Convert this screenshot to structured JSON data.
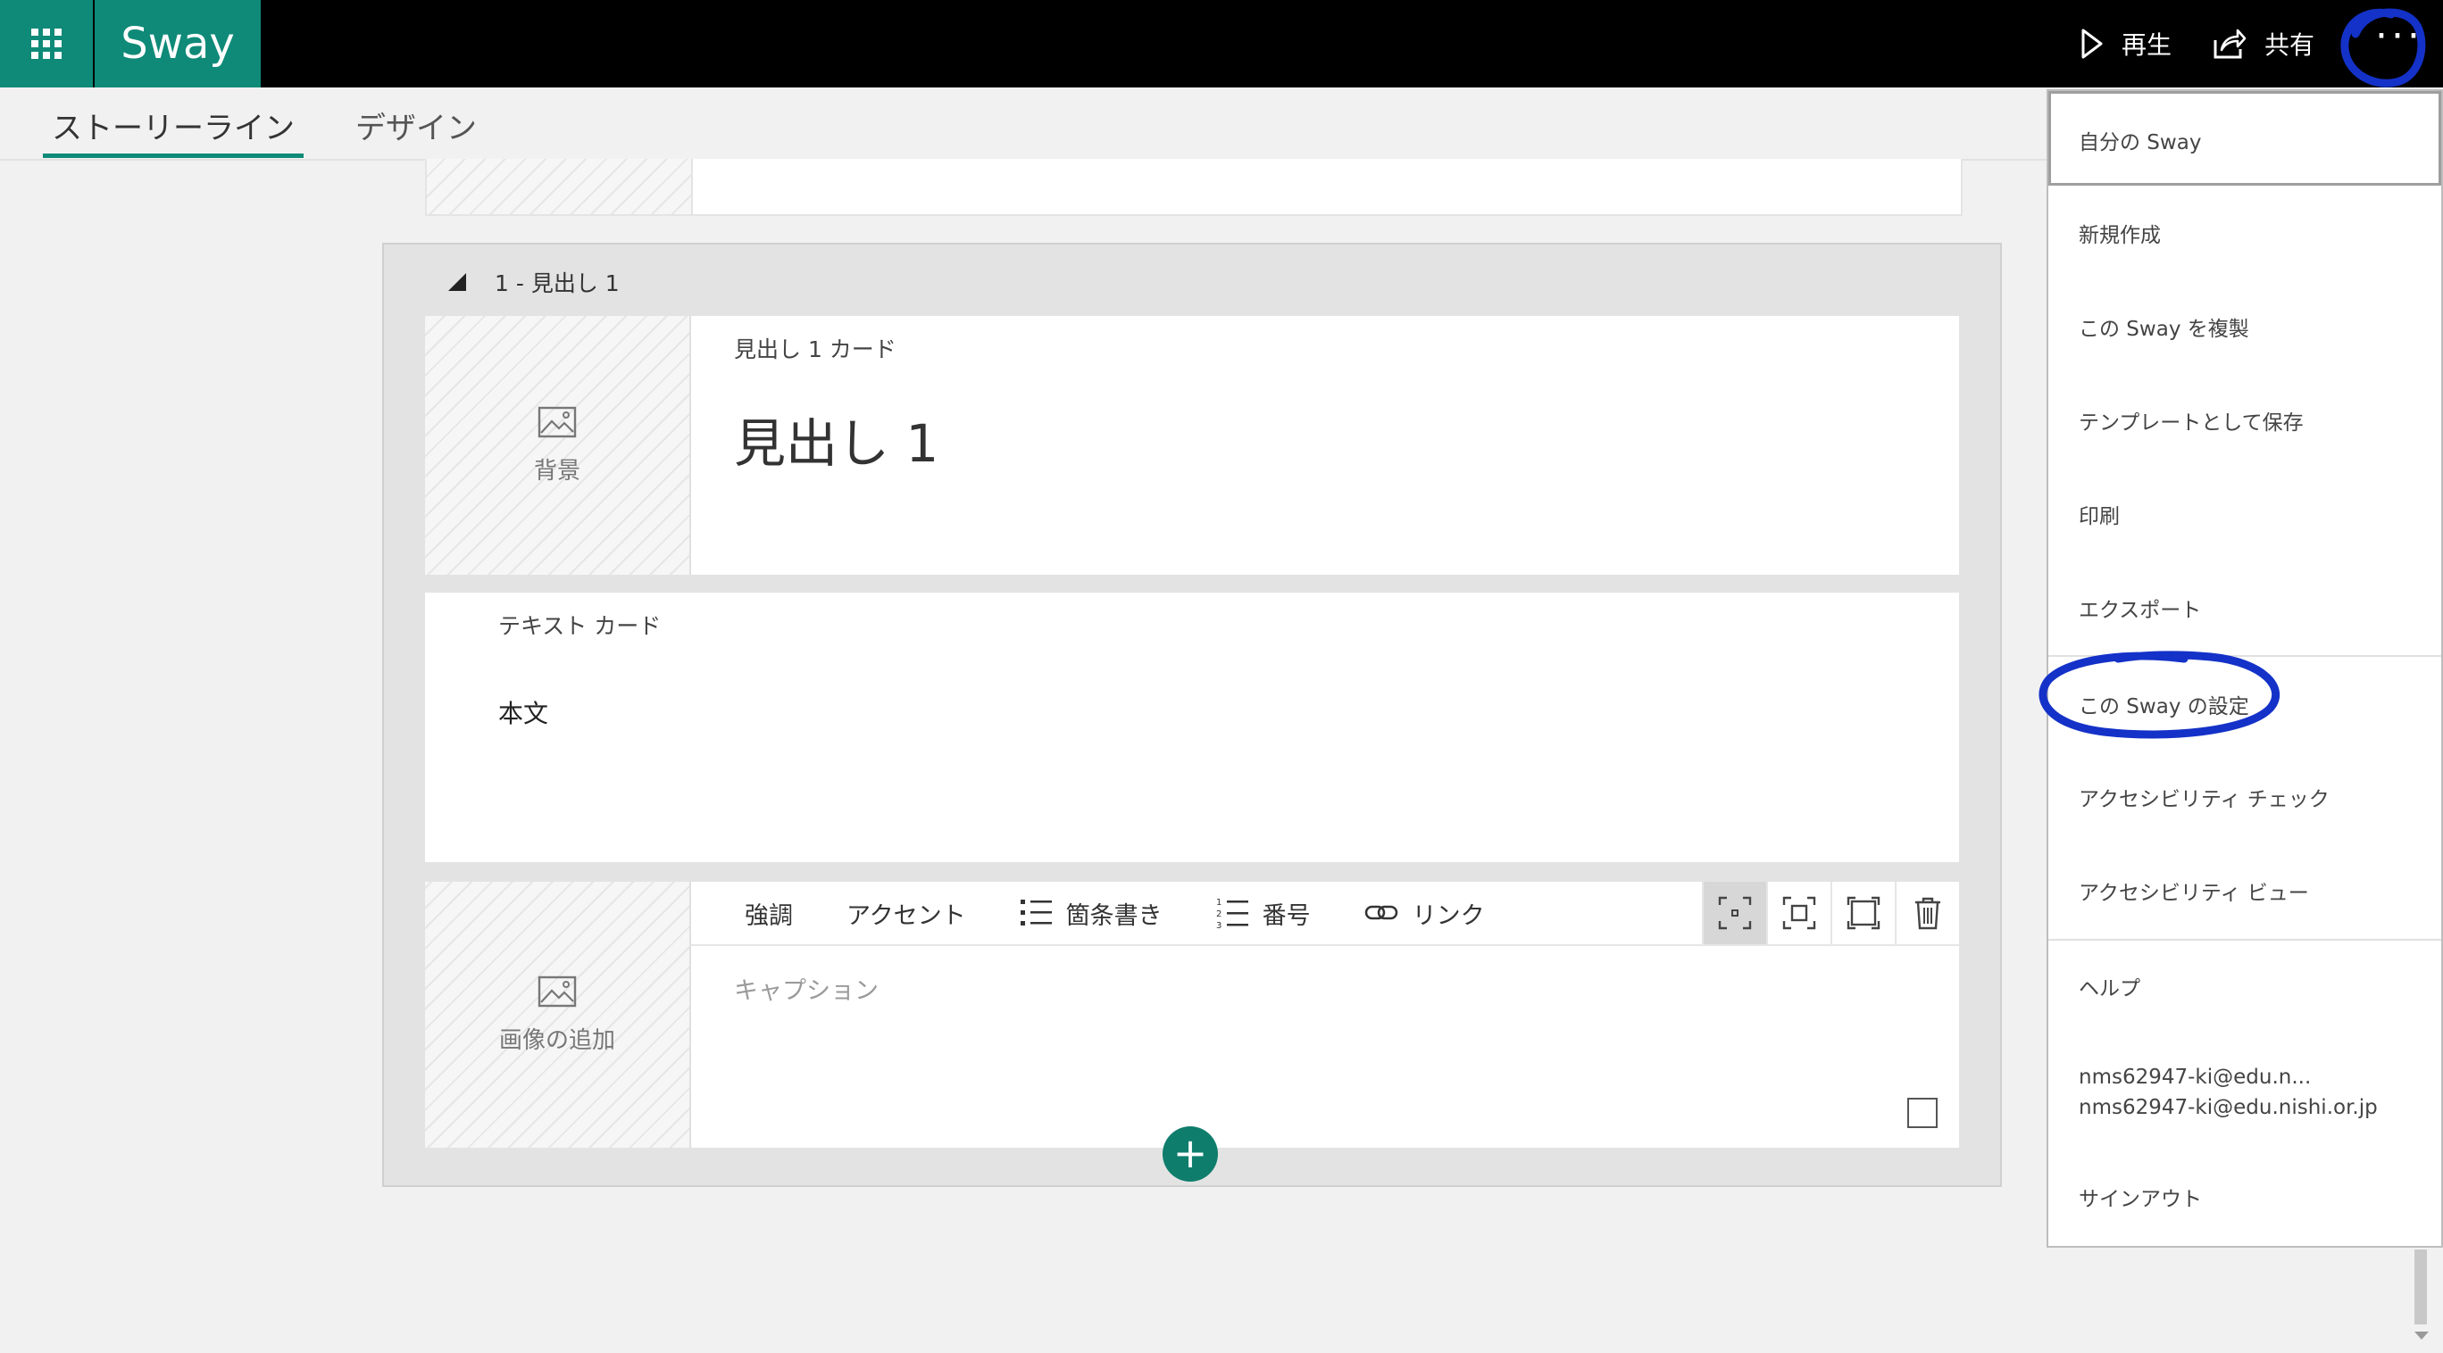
{
  "app": {
    "name": "Sway",
    "accent_color": "#0f8a78",
    "icons": {
      "launcher": "app-launcher-icon"
    }
  },
  "header": {
    "play_label": "再生",
    "share_label": "共有",
    "more_label": "···",
    "icons": {
      "play": "play-icon",
      "share": "share-icon",
      "more": "more-options-icon"
    },
    "annotation_color": "#1432c8"
  },
  "tabs": [
    {
      "label": "ストーリーライン",
      "active": true
    },
    {
      "label": "デザイン",
      "active": false
    }
  ],
  "storyline": {
    "section": {
      "title": "1 - 見出し 1",
      "heading_card": {
        "type_label": "見出し 1 カード",
        "background_label": "背景",
        "heading_text": "見出し 1"
      },
      "text_card": {
        "type_label": "テキスト カード",
        "body": "本文"
      },
      "image_card": {
        "add_image_label": "画像の追加",
        "caption_placeholder": "キャプション",
        "toolbar": {
          "emphasis": "強調",
          "accent": "アクセント",
          "bullets": "箇条書き",
          "numbering": "番号",
          "link": "リンク"
        },
        "size_icons": [
          "focus-small-icon",
          "focus-medium-icon",
          "focus-large-icon",
          "trash-icon"
        ]
      }
    },
    "add_button": "+"
  },
  "menu": {
    "items": [
      "自分の Sway",
      "新規作成",
      "この Sway を複製",
      "テンプレートとして保存",
      "印刷",
      "エクスポート",
      "この Sway の設定",
      "アクセシビリティ チェック",
      "アクセシビリティ ビュー",
      "ヘルプ"
    ],
    "account_short": "nms62947-ki@edu.n...",
    "account_full": "nms62947-ki@edu.nishi.or.jp",
    "sign_out": "サインアウト"
  }
}
